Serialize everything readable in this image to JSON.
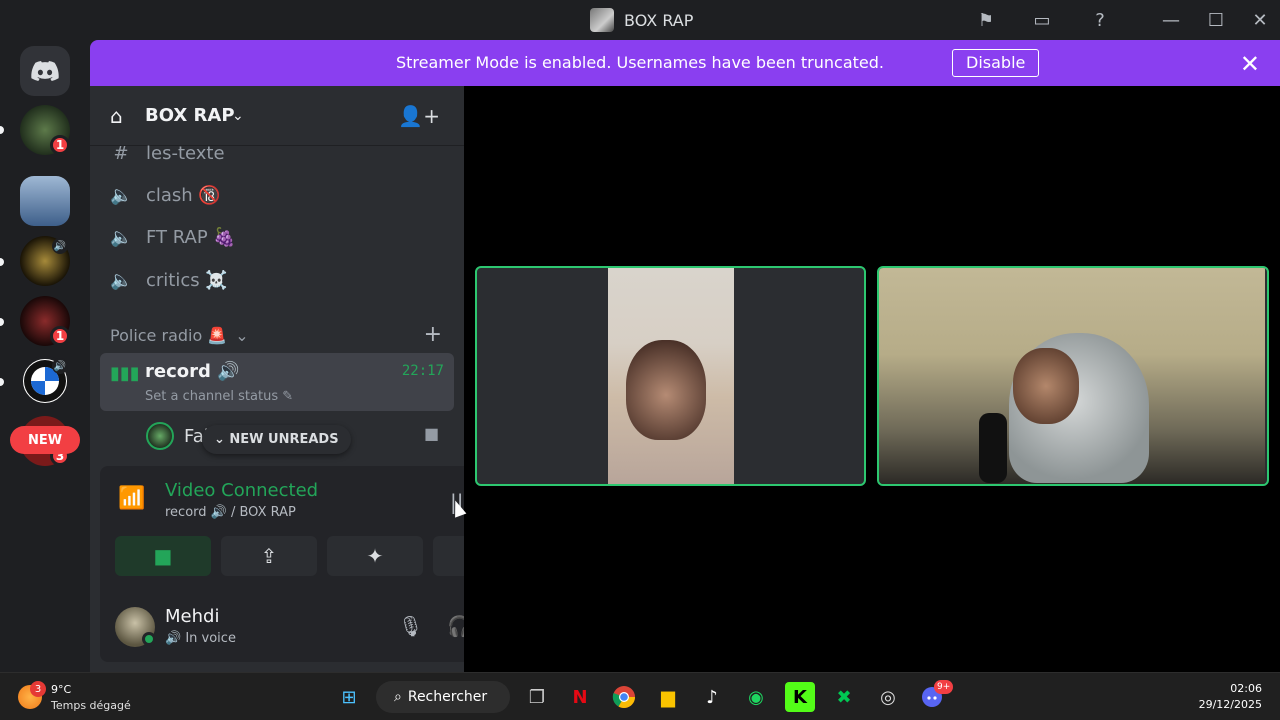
{
  "window": {
    "title": "BOX RAP"
  },
  "banner": {
    "message": "Streamer Mode is enabled. Usernames have been truncated.",
    "disable_label": "Disable"
  },
  "rail": {
    "new_label": "NEW",
    "badges": [
      "1",
      "1",
      "3"
    ]
  },
  "server": {
    "name": "BOX RAP"
  },
  "channels": [
    {
      "icon": "hash-icon",
      "name": "les-texte"
    },
    {
      "icon": "speaker-icon",
      "name": "clash 🔞"
    },
    {
      "icon": "speaker-icon",
      "name": "FT RAP 🍇"
    },
    {
      "icon": "speaker-icon",
      "name": "critics ☠️"
    }
  ],
  "category": {
    "name": "Police radio 🚨"
  },
  "active_channel": {
    "name": "record",
    "time": "22:17",
    "status_placeholder": "Set a channel status"
  },
  "member": {
    "name": "Fal"
  },
  "new_unreads": "NEW UNREADS",
  "voice": {
    "status": "Video Connected",
    "location": "record 🔊 / BOX RAP"
  },
  "user": {
    "name": "Mehdi",
    "status": "In voice"
  },
  "taskbar": {
    "weather_badge": "3",
    "temp": "9°C",
    "weather_desc": "Temps dégagé",
    "search_label": "Rechercher",
    "discord_badge": "9+",
    "time": "02:06",
    "date": "29/12/2025"
  },
  "colors": {
    "banner": "#8a3ff0",
    "connected": "#23a559",
    "tile_border": "#2dc770",
    "badge": "#f23f43"
  }
}
